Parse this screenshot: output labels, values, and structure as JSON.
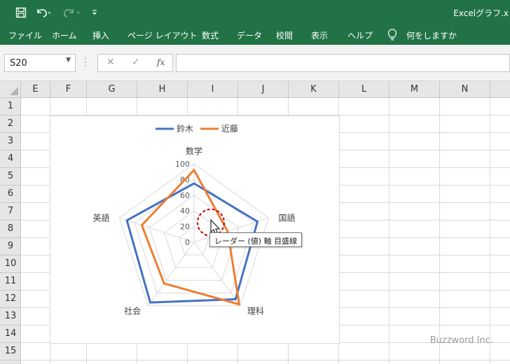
{
  "titlebar": {
    "title": "Excelグラフ.x",
    "icons": [
      "save-icon",
      "undo-icon",
      "redo-icon",
      "customize-qat-icon"
    ]
  },
  "menu": {
    "items": [
      "ファイル",
      "ホーム",
      "挿入",
      "ページ レイアウト",
      "数式",
      "データ",
      "校閲",
      "表示",
      "ヘルプ"
    ],
    "tell_me": "何をしますか"
  },
  "formula": {
    "name_box": "S20",
    "cancel_glyph": "✕",
    "enter_glyph": "✓",
    "fx_label": "fx",
    "value": ""
  },
  "columns": [
    "E",
    "F",
    "G",
    "H",
    "I",
    "J",
    "K",
    "L",
    "M",
    "N"
  ],
  "rows": [
    "1",
    "2",
    "3",
    "4",
    "5",
    "6",
    "7",
    "8",
    "9",
    "10",
    "11",
    "12",
    "13",
    "14",
    "15"
  ],
  "colors": {
    "excel_green": "#217346",
    "series_suzuki": "#4472C4",
    "series_kondo": "#ED7D31",
    "highlight": "#C00000"
  },
  "chart_data": {
    "type": "radar",
    "categories": [
      "数学",
      "国語",
      "理科",
      "社会",
      "英語"
    ],
    "series": [
      {
        "name": "鈴木",
        "values": [
          75,
          85,
          90,
          95,
          90
        ],
        "color": "#4472C4"
      },
      {
        "name": "近藤",
        "values": [
          92,
          45,
          98,
          65,
          70
        ],
        "color": "#ED7D31"
      }
    ],
    "r_ticks": [
      "0",
      "20",
      "40",
      "60",
      "80",
      "100"
    ],
    "rlim": [
      0,
      100
    ],
    "legend_position": "top"
  },
  "tooltip": {
    "text": "レーダー (値) 軸 目盛線"
  },
  "watermark": "Buzzword Inc."
}
